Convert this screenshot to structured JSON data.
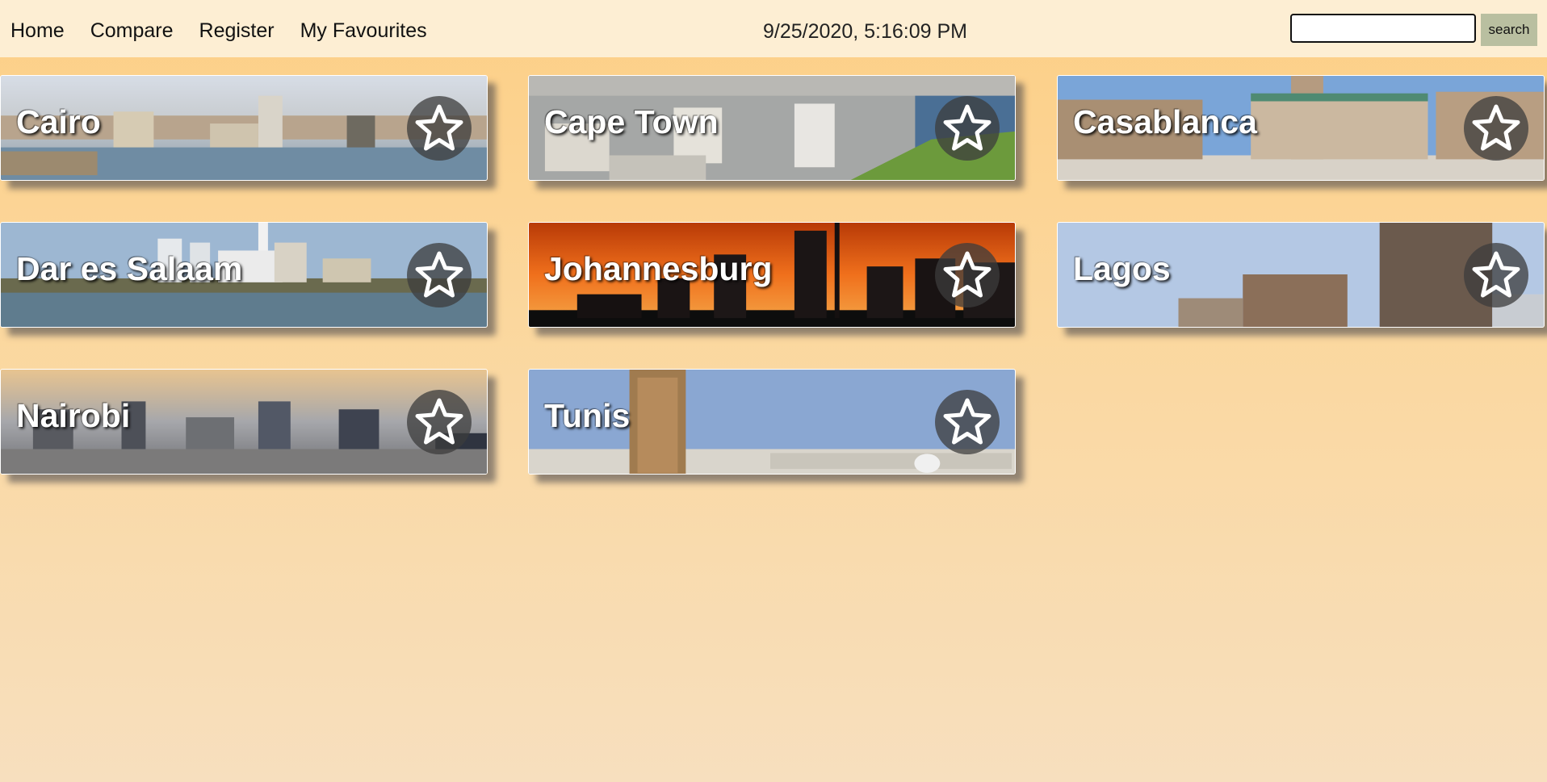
{
  "nav": {
    "home": "Home",
    "compare": "Compare",
    "register": "Register",
    "favourites": "My Favourites"
  },
  "clock": "9/25/2020, 5:16:09 PM",
  "search": {
    "value": "",
    "button_label": "search"
  },
  "cities": [
    {
      "name": "Cairo",
      "favourite": false
    },
    {
      "name": "Cape Town",
      "favourite": false
    },
    {
      "name": "Casablanca",
      "favourite": false
    },
    {
      "name": "Dar es Salaam",
      "favourite": false
    },
    {
      "name": "Johannesburg",
      "favourite": false
    },
    {
      "name": "Lagos",
      "favourite": false
    },
    {
      "name": "Nairobi",
      "favourite": false
    },
    {
      "name": "Tunis",
      "favourite": false
    }
  ],
  "icons": {
    "favourite": "star-outline-icon"
  }
}
